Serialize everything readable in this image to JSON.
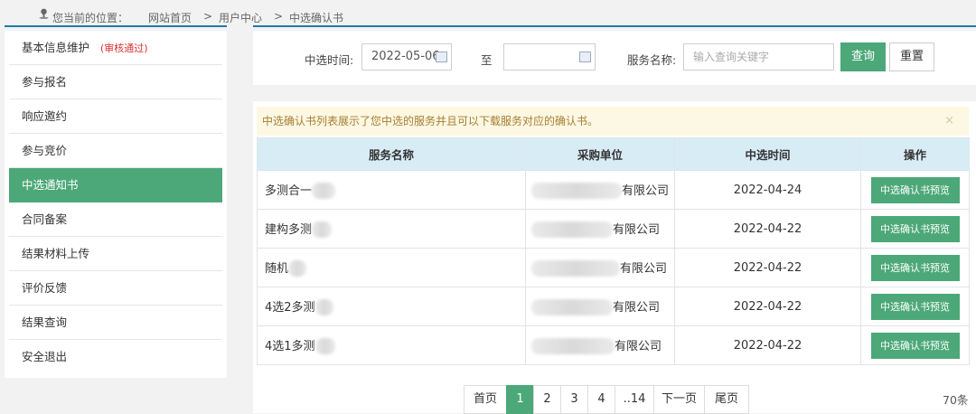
{
  "breadcrumb": {
    "prefix": "您当前的位置：",
    "home": "网站首页",
    "sep1": ">",
    "user_center": "用户中心",
    "sep2": ">",
    "current": "中选确认书"
  },
  "sidebar": {
    "items": [
      {
        "label": "基本信息维护",
        "badge": "(审核通过)"
      },
      {
        "label": "参与报名"
      },
      {
        "label": "响应邀约"
      },
      {
        "label": "参与竞价"
      },
      {
        "label": "中选通知书",
        "active": true
      },
      {
        "label": "合同备案"
      },
      {
        "label": "结果材料上传"
      },
      {
        "label": "评价反馈"
      },
      {
        "label": "结果查询"
      },
      {
        "label": "安全退出"
      }
    ]
  },
  "filter": {
    "time_label": "中选时间:",
    "date_from": "2022-05-06",
    "to_label": "至",
    "date_to": "",
    "service_label": "服务名称:",
    "service_placeholder": "输入查询关键字",
    "query_label": "查询",
    "reset_label": "重置"
  },
  "notice": {
    "text": "中选确认书列表展示了您中选的服务并且可以下载服务对应的确认书。",
    "close": "×"
  },
  "table": {
    "headers": [
      "服务名称",
      "采购单位",
      "中选时间",
      "操作"
    ],
    "rows": [
      {
        "name": "多测合一",
        "org_suffix": "有限公司",
        "date": "2022-04-24",
        "action": "中选确认书预览"
      },
      {
        "name": "建构多测",
        "org_suffix": "有限公司",
        "date": "2022-04-22",
        "action": "中选确认书预览"
      },
      {
        "name": "随机",
        "org_suffix": "有限公司",
        "date": "2022-04-22",
        "action": "中选确认书预览"
      },
      {
        "name": "4选2多测",
        "org_suffix": "有限公司",
        "date": "2022-04-22",
        "action": "中选确认书预览"
      },
      {
        "name": "4选1多测",
        "org_suffix": "有限公司",
        "date": "2022-04-22",
        "action": "中选确认书预览"
      }
    ]
  },
  "pager": {
    "first": "首页",
    "pages": [
      "1",
      "2",
      "3",
      "4",
      "..14"
    ],
    "current": "1",
    "next": "下一页",
    "last": "尾页",
    "total": "70条"
  },
  "colors": {
    "accent": "#4ca878",
    "header_line": "#1f7aa8",
    "notice_bg": "#fcf8e3",
    "badge": "#d83131"
  }
}
